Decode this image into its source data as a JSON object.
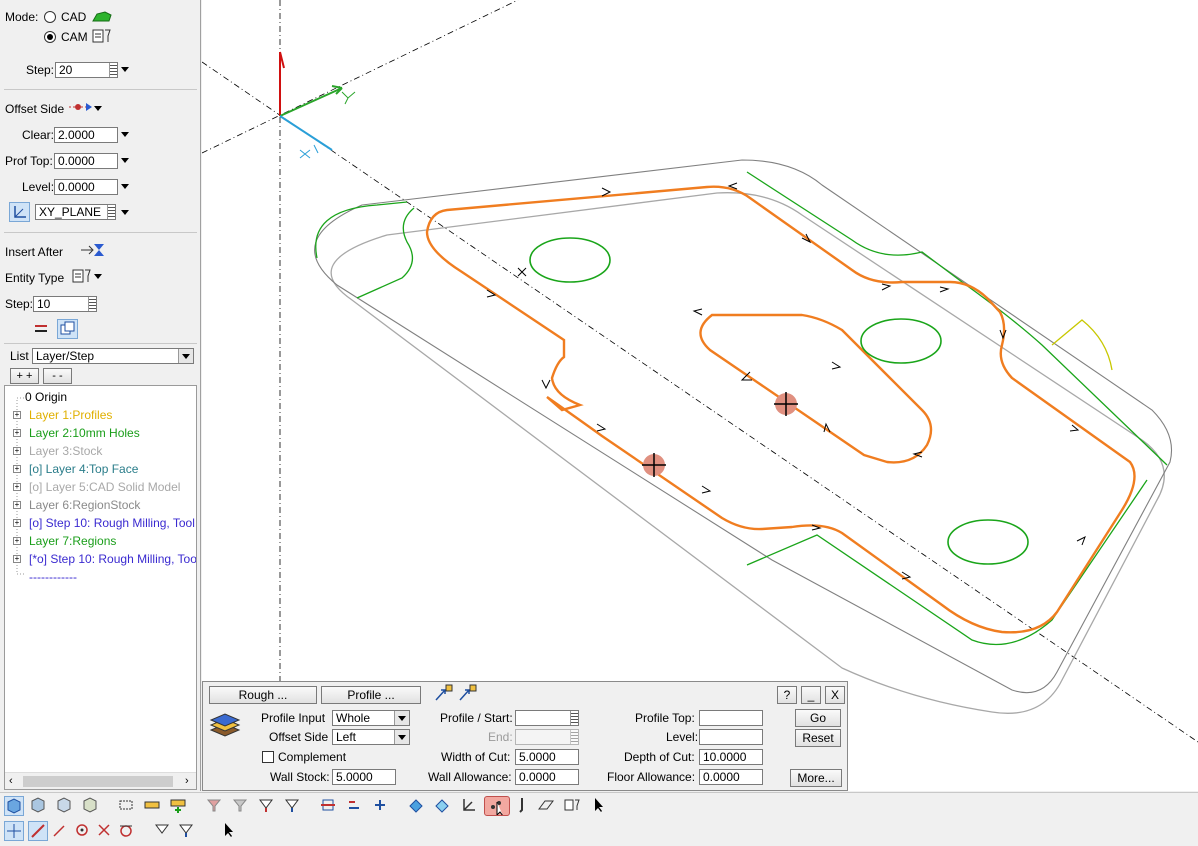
{
  "left_panel": {
    "mode_label": "Mode:",
    "mode_cad": "CAD",
    "mode_cam": "CAM",
    "mode_selected": "CAM",
    "step_label": "Step:",
    "step_value": "20",
    "offset_side_label": "Offset Side",
    "clear_label": "Clear:",
    "clear_value": "2.0000",
    "prof_top_label": "Prof Top:",
    "prof_top_value": "0.0000",
    "level_label": "Level:",
    "level_value": "0.0000",
    "plane_value": "XY_PLANE",
    "insert_after_label": "Insert After",
    "entity_type_label": "Entity Type",
    "step2_label": "Step:",
    "step2_value": "10",
    "list_label": "List",
    "list_value": "Layer/Step",
    "expand_button": "+ +",
    "collapse_button": "- -"
  },
  "tree": {
    "items": [
      {
        "label": "0 Origin",
        "color": "#000000"
      },
      {
        "label": "Layer 1:Profiles",
        "color": "#e0b000"
      },
      {
        "label": "Layer 2:10mm Holes",
        "color": "#1a9e1a"
      },
      {
        "label": "Layer 3:Stock",
        "color": "#a8a8a8"
      },
      {
        "label": "[o] Layer 4:Top Face",
        "color": "#2a7d8a"
      },
      {
        "label": "[o] Layer 5:CAD Solid Model",
        "color": "#a8a8a8"
      },
      {
        "label": "Layer 6:RegionStock",
        "color": "#8a8a8a"
      },
      {
        "label": "[o] Step 10: Rough Milling, Tool",
        "color": "#3a2ad0"
      },
      {
        "label": "Layer 7:Regions",
        "color": "#1a9e1a"
      },
      {
        "label": "[*o] Step 10: Rough Milling, Too",
        "color": "#3a2ad0"
      },
      {
        "label": "------------",
        "color": "#3a2ad0"
      }
    ]
  },
  "dialog": {
    "tab_rough": "Rough ...",
    "tab_profile": "Profile ...",
    "help_button": "?",
    "min_button": "_",
    "close_button": "X",
    "profile_input_label": "Profile Input",
    "profile_input_value": "Whole",
    "offset_side_label": "Offset Side",
    "offset_side_value": "Left",
    "complement_label": "Complement",
    "wall_stock_label": "Wall Stock:",
    "wall_stock_value": "5.0000",
    "profile_start_label": "Profile / Start:",
    "profile_start_value": "",
    "end_label": "End:",
    "end_value": "",
    "width_of_cut_label": "Width of Cut:",
    "width_of_cut_value": "5.0000",
    "wall_allowance_label": "Wall Allowance:",
    "wall_allowance_value": "0.0000",
    "profile_top_label": "Profile Top:",
    "profile_top_value": "",
    "level_label": "Level:",
    "level_value": "",
    "depth_of_cut_label": "Depth of Cut:",
    "depth_of_cut_value": "10.0000",
    "floor_allowance_label": "Floor Allowance:",
    "floor_allowance_value": "0.0000",
    "go_button": "Go",
    "reset_button": "Reset",
    "more_button": "More..."
  },
  "colors": {
    "toolpath": "#f07d20",
    "holes": "#1aa51a",
    "stock": "#a0a0a0",
    "axis_x": "#2a9fd8",
    "axis_y": "#2aa52a",
    "axis_z": "#d01010"
  }
}
